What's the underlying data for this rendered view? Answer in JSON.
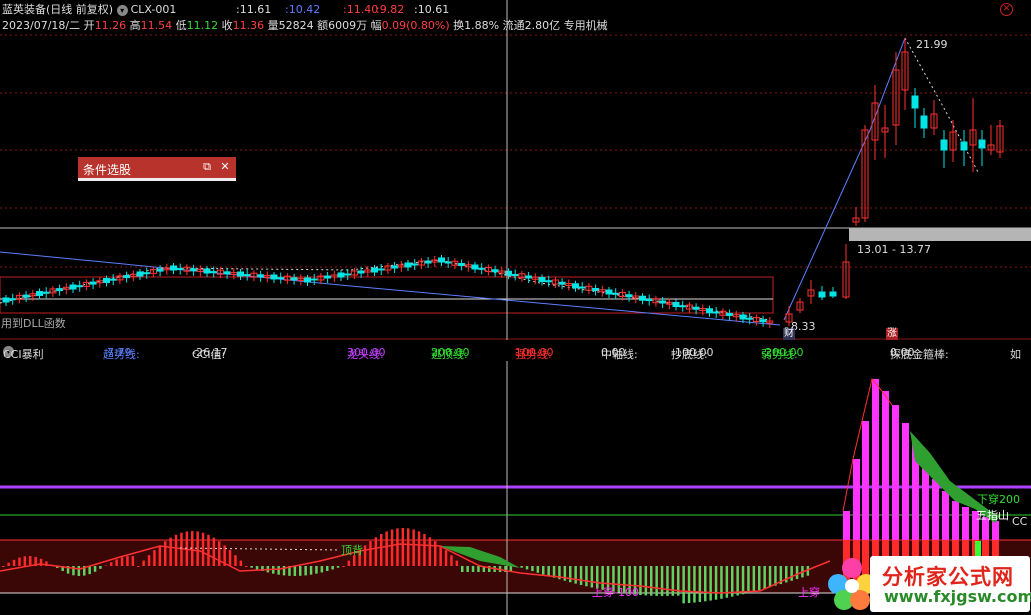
{
  "header": {
    "stock_name": "蓝英装备",
    "period_label": "(日线 前复权)",
    "formula_name": "CLX-001",
    "indicator_values": [
      ":11.61",
      ":10.42",
      ":11.40",
      ":9.82",
      ":10.61"
    ],
    "date_label": "2023/07/18/二",
    "open_label": "开",
    "open": "11.26",
    "high_label": "高",
    "high": "11.54",
    "low_label": "低",
    "low": "11.12",
    "close_label": "收",
    "close": "11.36",
    "volume_label": "量",
    "volume": "52824",
    "amount_label": "额",
    "amount": "6009万",
    "change_label": "幅",
    "change": "0.09(0.80%)",
    "turnover_label": "换",
    "turnover": "1.88%",
    "float_label": "流通",
    "float_cap": "2.80亿",
    "sector": "专用机械"
  },
  "condition_dialog": {
    "title": "条件选股"
  },
  "price_labels": {
    "peak": "21.99",
    "range": "13.01 - 13.77",
    "low": "8.33",
    "dll_note": "用到DLL函数",
    "finance_badge": "财",
    "rise_badge": "涨"
  },
  "indicator": {
    "name": "CCI暴利",
    "items": [
      {
        "label": "趋势线: ",
        "value": "-7.79",
        "color": "#5b7fff"
      },
      {
        "label": "CCI值: ",
        "value": "-26.17",
        "color": "#dddddd"
      },
      {
        "label": "龙头线: ",
        "value": "300.00",
        "color": "#c040ff"
      },
      {
        "label": "逃顶线: ",
        "value": "200.00",
        "color": "#33dd33"
      },
      {
        "label": "强势线: ",
        "value": "100.00",
        "color": "#ff3030"
      },
      {
        "label": "中轴线: ",
        "value": "0.00",
        "color": "#dddddd"
      },
      {
        "label": "抄底线: ",
        "value": "-100.00",
        "color": "#dddddd"
      },
      {
        "label": "弱势线: ",
        "value": "-200.00",
        "color": "#33dd33"
      },
      {
        "label": "探底金箍棒: ",
        "value": "0.00",
        "color": "#dddddd"
      },
      {
        "label": "如",
        "value": "",
        "color": "#dddddd"
      }
    ],
    "annotations": {
      "top_divergence": "顶背",
      "cross_down_200": "下穿200",
      "five_finger": "五指山",
      "cc": "CC",
      "cross_up_left": "上穿-100",
      "cross_up_right": "上穿"
    }
  },
  "watermark": {
    "text_cn": "分析家公式网",
    "text_url": "www.fxjgsw.com"
  },
  "colors": {
    "up": "#ff3030",
    "down": "#00ffff",
    "grid": "#7a1a1a",
    "purple": "#c040ff",
    "green": "#33cc33",
    "magenta": "#ff33ff"
  }
}
